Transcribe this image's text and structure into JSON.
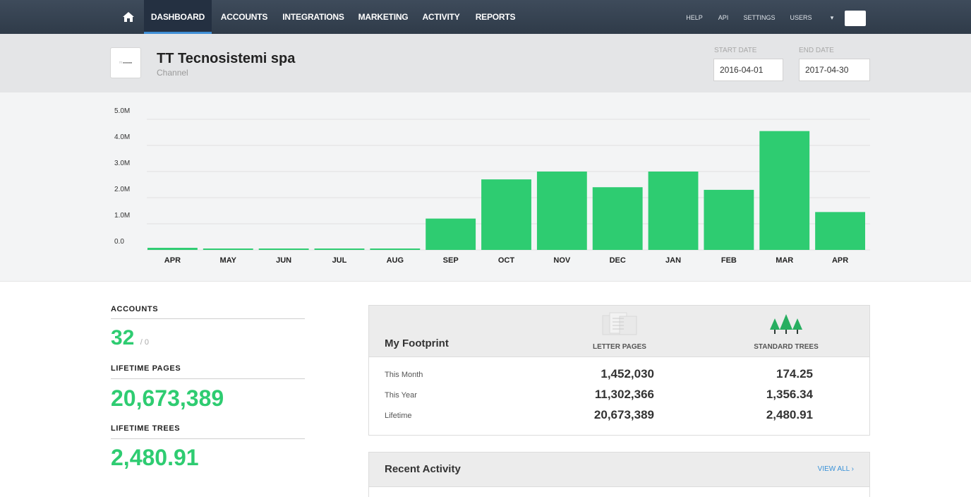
{
  "nav": {
    "items": [
      "DASHBOARD",
      "ACCOUNTS",
      "INTEGRATIONS",
      "MARKETING",
      "ACTIVITY",
      "REPORTS"
    ],
    "right_items": [
      "HELP",
      "API",
      "SETTINGS",
      "USERS",
      "▾"
    ]
  },
  "header": {
    "company": "TT Tecnosistemi spa",
    "subtitle": "Channel",
    "start_date_label": "START DATE",
    "start_date": "2016-04-01",
    "end_date_label": "END DATE",
    "end_date": "2017-04-30"
  },
  "chart_data": {
    "type": "bar",
    "categories": [
      "APR",
      "MAY",
      "JUN",
      "JUL",
      "AUG",
      "SEP",
      "OCT",
      "NOV",
      "DEC",
      "JAN",
      "FEB",
      "MAR",
      "APR"
    ],
    "values": [
      0.08,
      0.03,
      0.02,
      0.02,
      0.02,
      1.2,
      2.7,
      3.0,
      2.4,
      3.0,
      2.3,
      4.55,
      1.45
    ],
    "yticks": [
      "0.0",
      "1.0M",
      "2.0M",
      "3.0M",
      "4.0M",
      "5.0M"
    ],
    "ylim": [
      0,
      5
    ],
    "color": "#2ecc71"
  },
  "stats": {
    "accounts_label": "ACCOUNTS",
    "accounts": "32",
    "accounts_sub": "/ 0",
    "pages_label": "LIFETIME PAGES",
    "pages": "20,673,389",
    "trees_label": "LIFETIME TREES",
    "trees": "2,480.91"
  },
  "footprint": {
    "title": "My Footprint",
    "col_pages": "LETTER PAGES",
    "col_trees": "STANDARD TREES",
    "rows": [
      {
        "label": "This Month",
        "pages": "1,452,030",
        "trees": "174.25"
      },
      {
        "label": "This Year",
        "pages": "11,302,366",
        "trees": "1,356.34"
      },
      {
        "label": "Lifetime",
        "pages": "20,673,389",
        "trees": "2,480.91"
      }
    ]
  },
  "activity": {
    "title": "Recent Activity",
    "view_all": "VIEW ALL ›"
  },
  "icons": {
    "home": "home-icon",
    "pages": "document-icon",
    "trees": "trees-icon"
  }
}
